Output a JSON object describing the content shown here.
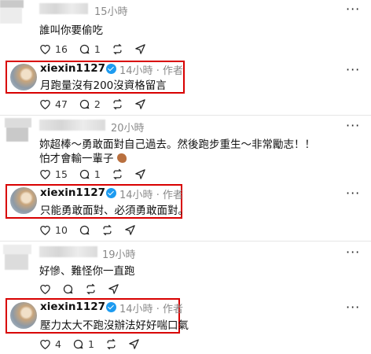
{
  "thread": [
    {
      "comment": {
        "time": "15小時",
        "text_lines": [
          "誰叫你要偷吃"
        ],
        "likes": "16",
        "replies": "1"
      },
      "reply": {
        "username": "xiexin1127",
        "time": "14小時",
        "sep": "·",
        "role": "作者",
        "text": "月跑量沒有200沒資格留言",
        "likes": "47",
        "replies": "2"
      }
    },
    {
      "comment": {
        "time": "20小時",
        "text_lines": [
          "妳超棒～勇敢面對自己過去。然後跑步重生～非常勵志！！",
          "怕才會輸一輩子"
        ],
        "likes": "15",
        "replies": "1"
      },
      "reply": {
        "username": "xiexin1127",
        "time": "14小時",
        "sep": "·",
        "role": "作者",
        "text": "只能勇敢面對、必須勇敢面對。",
        "likes": "10",
        "replies": ""
      }
    },
    {
      "comment": {
        "time": "19小時",
        "text_lines": [
          "好慘、難怪你一直跑"
        ],
        "likes": "",
        "replies": ""
      },
      "reply": {
        "username": "xiexin1127",
        "time": "14小時",
        "sep": "·",
        "role": "作者",
        "text": "壓力太大不跑沒辦法好好喘口氣",
        "likes": "4",
        "replies": "1"
      }
    }
  ],
  "icons": {
    "like": "heart-icon",
    "reply": "comment-icon",
    "repost": "repost-icon",
    "share": "share-icon",
    "more": "more-icon",
    "verified": "verified-badge-icon",
    "emoji": "flexed-bicep-emoji"
  },
  "colors": {
    "highlight_border": "#d80000",
    "verified": "#1d9bf0",
    "meta_text": "#8a8a8a"
  }
}
